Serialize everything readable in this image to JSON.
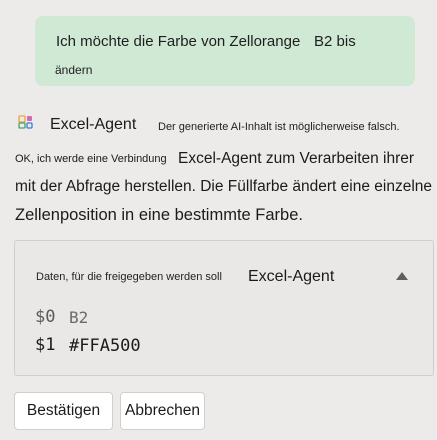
{
  "user_message": {
    "part1": "Ich möchte die Farbe von Zellorange",
    "part2": "B2 bis",
    "part3": "ändern"
  },
  "agent": {
    "name": "Excel-Agent",
    "disclaimer": "Der generierte AI-Inhalt ist möglicherweise falsch.",
    "icon": "excel-agent-icon"
  },
  "response": {
    "line1_small": "OK, ich werde eine Verbindung",
    "line1_large": "Excel-Agent zum Verarbeiten ihrer",
    "line2": "mit der Abfrage herstellen. Die Füllfarbe ändert eine einzelne",
    "line3": "Zellenposition in eine bestimmte Farbe."
  },
  "share_card": {
    "label": "Daten, für die freigegeben werden soll",
    "agent": "Excel-Agent",
    "collapse_icon": "caret-up-icon",
    "params": [
      {
        "key": "$0",
        "value": "B2"
      },
      {
        "key": "$1",
        "value": "#FFA500"
      }
    ]
  },
  "buttons": {
    "confirm": "Bestätigen",
    "cancel": "Abbrechen"
  },
  "colors": {
    "background": "#ecebea",
    "user_bubble": "#cfe9d5",
    "button_bg": "#ffffff"
  }
}
